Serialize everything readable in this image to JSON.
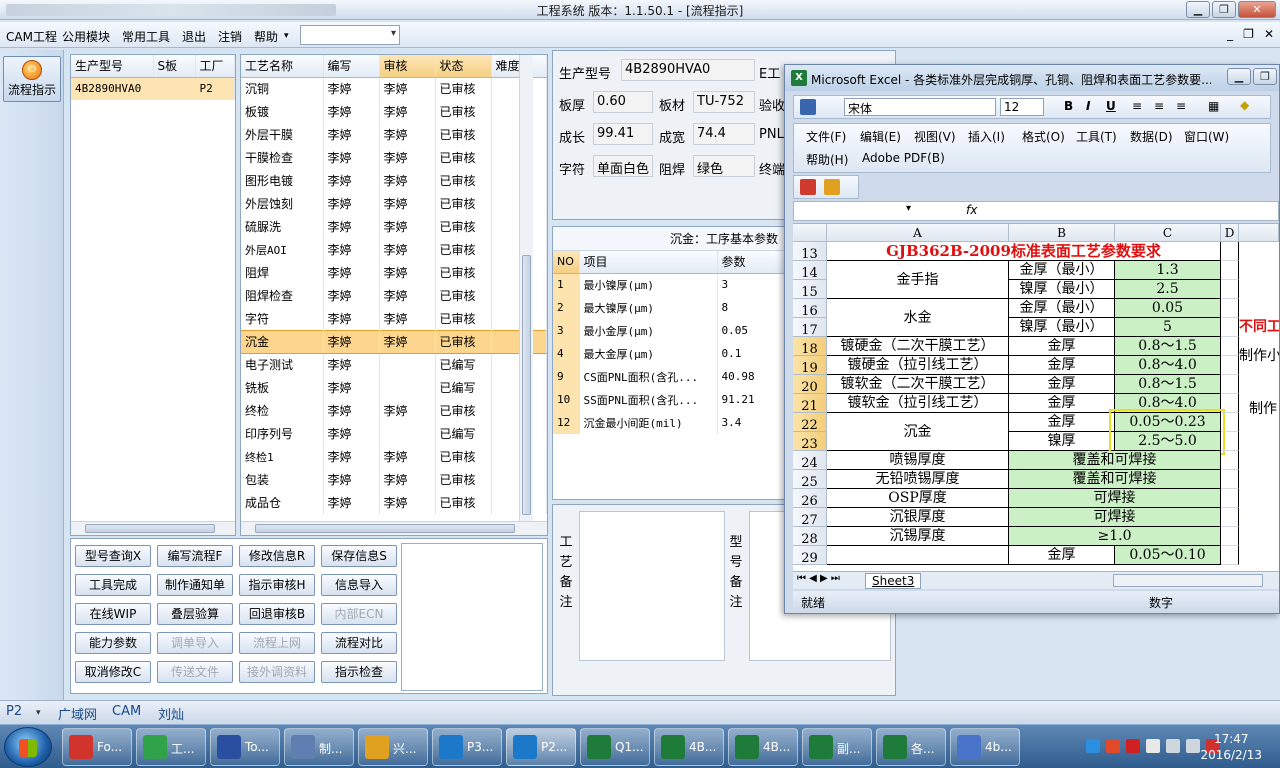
{
  "window": {
    "title": "工程系统  版本：1.1.50.1 - [流程指示]"
  },
  "menu": {
    "items": [
      "CAM工程",
      "公用模块",
      "常用工具",
      "退出",
      "注销",
      "帮助"
    ],
    "mdi": [
      "_",
      "❐",
      "✕"
    ]
  },
  "nav": {
    "flow_label": "流程指示"
  },
  "model_table": {
    "headers": [
      "生产型号",
      "S板",
      "工厂"
    ],
    "row": {
      "model": "4B2890HVA0",
      "s": "",
      "factory": "P2"
    }
  },
  "process_table": {
    "headers": [
      "工艺名称",
      "编写",
      "审核",
      "状态",
      "难度"
    ],
    "rows": [
      [
        "沉铜",
        "李婷",
        "李婷",
        "已审核",
        ""
      ],
      [
        "板镀",
        "李婷",
        "李婷",
        "已审核",
        ""
      ],
      [
        "外层干膜",
        "李婷",
        "李婷",
        "已审核",
        ""
      ],
      [
        "干膜检查",
        "李婷",
        "李婷",
        "已审核",
        ""
      ],
      [
        "图形电镀",
        "李婷",
        "李婷",
        "已审核",
        ""
      ],
      [
        "外层蚀刻",
        "李婷",
        "李婷",
        "已审核",
        ""
      ],
      [
        "硫脲洗",
        "李婷",
        "李婷",
        "已审核",
        ""
      ],
      [
        "外层AOI",
        "李婷",
        "李婷",
        "已审核",
        ""
      ],
      [
        "阻焊",
        "李婷",
        "李婷",
        "已审核",
        ""
      ],
      [
        "阻焊检查",
        "李婷",
        "李婷",
        "已审核",
        ""
      ],
      [
        "字符",
        "李婷",
        "李婷",
        "已审核",
        ""
      ],
      [
        "沉金",
        "李婷",
        "李婷",
        "已审核",
        ""
      ],
      [
        "电子测试",
        "李婷",
        "",
        "已编写",
        ""
      ],
      [
        "铣板",
        "李婷",
        "",
        "已编写",
        ""
      ],
      [
        "终检",
        "李婷",
        "李婷",
        "已审核",
        ""
      ],
      [
        "印序列号",
        "李婷",
        "",
        "已编写",
        ""
      ],
      [
        "终检1",
        "李婷",
        "李婷",
        "已审核",
        ""
      ],
      [
        "包装",
        "李婷",
        "李婷",
        "已审核",
        ""
      ],
      [
        "成品仓",
        "李婷",
        "李婷",
        "已审核",
        ""
      ]
    ],
    "selected_index": 11
  },
  "buttons": [
    {
      "label": "型号查询X",
      "enabled": true
    },
    {
      "label": "编写流程F",
      "enabled": true
    },
    {
      "label": "修改信息R",
      "enabled": true
    },
    {
      "label": "保存信息S",
      "enabled": true
    },
    {
      "label": "工具完成",
      "enabled": true
    },
    {
      "label": "制作通知单",
      "enabled": true
    },
    {
      "label": "指示审核H",
      "enabled": true
    },
    {
      "label": "信息导入",
      "enabled": true
    },
    {
      "label": "在线WIP",
      "enabled": true
    },
    {
      "label": "叠层验算",
      "enabled": true
    },
    {
      "label": "回退审核B",
      "enabled": true
    },
    {
      "label": "内部ECN",
      "enabled": false
    },
    {
      "label": "能力参数",
      "enabled": true
    },
    {
      "label": "调单导入",
      "enabled": false
    },
    {
      "label": "流程上网",
      "enabled": false
    },
    {
      "label": "流程对比",
      "enabled": true
    },
    {
      "label": "取消修改C",
      "enabled": true
    },
    {
      "label": "传送文件",
      "enabled": false
    },
    {
      "label": "接外调资料",
      "enabled": false
    },
    {
      "label": "指示检查",
      "enabled": true
    }
  ],
  "form": {
    "model_label": "生产型号",
    "model_value": "4B2890HVA0",
    "e_label": "E工",
    "thick_label": "板厚",
    "thick_value": "0.60",
    "material_label": "板材",
    "material_value": "TU-752",
    "check_label": "验收",
    "len_label": "成长",
    "len_value": "99.41",
    "width_label": "成宽",
    "width_value": "74.4",
    "pnl_label": "PNL",
    "char_label": "字符",
    "char_value": "单面白色",
    "mask_label": "阻焊",
    "mask_value": "绿色",
    "end_label": "终端"
  },
  "params": {
    "caption": "沉金：工序基本参数",
    "headers": [
      "NO",
      "项目",
      "参数"
    ],
    "rows": [
      [
        "1",
        "最小镍厚(μm)",
        "3"
      ],
      [
        "2",
        "最大镍厚(μm)",
        "8"
      ],
      [
        "3",
        "最小金厚(μm)",
        "0.05"
      ],
      [
        "4",
        "最大金厚(μm)",
        "0.1"
      ],
      [
        "9",
        "CS面PNL面积(含孔...",
        "40.98"
      ],
      [
        "10",
        "SS面PNL面积(含孔...",
        "91.21"
      ],
      [
        "12",
        "沉金最小间距(mil)",
        "3.4"
      ]
    ]
  },
  "remarks": {
    "process_label": "工艺备注",
    "model_label": "型号备注"
  },
  "excel": {
    "title": "Microsoft Excel - 各类标准外层完成铜厚、孔铜、阻焊和表面工艺参数要...",
    "font": "宋体",
    "font_size": "12",
    "menus": [
      "文件(F)",
      "编辑(E)",
      "视图(V)",
      "插入(I)",
      "格式(O)",
      "工具(T)",
      "数据(D)",
      "窗口(W)"
    ],
    "menus2": [
      "帮助(H)",
      "Adobe PDF(B)"
    ],
    "columns": [
      "A",
      "B",
      "C",
      "D"
    ],
    "row_numbers": [
      "13",
      "14",
      "15",
      "16",
      "17",
      "18",
      "19",
      "20",
      "21",
      "22",
      "23",
      "24",
      "25",
      "26",
      "27",
      "28",
      "29"
    ],
    "heading": "GJB362B-2009标准表面工艺参数要求",
    "cells": {
      "jinshouzhi": "金手指",
      "shuijin": "水金",
      "b14": "金厚（最小）",
      "c14": "1.3",
      "b15": "镍厚（最小）",
      "c15": "2.5",
      "b16": "金厚（最小）",
      "c16": "0.05",
      "b17": "镍厚（最小）",
      "c17": "5",
      "a18": "镀硬金（二次干膜工艺）",
      "b18": "金厚",
      "c18": "0.8～1.5",
      "a19": "镀硬金（拉引线工艺）",
      "b19": "金厚",
      "c19": "0.8～4.0",
      "a20": "镀软金（二次干膜工艺）",
      "b20": "金厚",
      "c20": "0.8～1.5",
      "a21": "镀软金（拉引线工艺）",
      "b21": "金厚",
      "c21": "0.8～4.0",
      "a22": "沉金",
      "b22": "金厚",
      "c22": "0.05～0.23",
      "b23": "镍厚",
      "c23": "2.5～5.0",
      "a24": "喷锡厚度",
      "bc24": "覆盖和可焊接",
      "a25": "无铅喷锡厚度",
      "bc25": "覆盖和可焊接",
      "a26": "OSP厚度",
      "bc26": "可焊接",
      "a27": "沉银厚度",
      "bc27": "可焊接",
      "a28": "沉锡厚度",
      "bc28": "≥1.0",
      "b29": "金厚",
      "c29": "0.05～0.10",
      "e17": "不同工",
      "e19": "制作小",
      "e21": "制作"
    },
    "sheet_tab": "Sheet3",
    "status_ready": "就绪",
    "status_num": "数字"
  },
  "statusbar": {
    "factory": "P2",
    "network": "广域网",
    "dept": "CAM",
    "user": "刘灿"
  },
  "taskbar": {
    "tasks": [
      {
        "label": "Fo...",
        "color": "#d0342c"
      },
      {
        "label": "工...",
        "color": "#2fa24a"
      },
      {
        "label": "To...",
        "color": "#2a4fa0"
      },
      {
        "label": "制...",
        "color": "#5f7fb0"
      },
      {
        "label": "兴...",
        "color": "#e0a020"
      },
      {
        "label": "P3...",
        "color": "#1c79c9"
      },
      {
        "label": "P2...",
        "color": "#1c79c9"
      },
      {
        "label": "Q1...",
        "color": "#1e7b3a"
      },
      {
        "label": "4B...",
        "color": "#1e7b3a"
      },
      {
        "label": "4B...",
        "color": "#1e7b3a"
      },
      {
        "label": "副...",
        "color": "#1e7b3a"
      },
      {
        "label": "各...",
        "color": "#1e7b3a"
      },
      {
        "label": "4b...",
        "color": "#4a74c9"
      }
    ],
    "time": "17:47",
    "date": "2016/2/13"
  }
}
